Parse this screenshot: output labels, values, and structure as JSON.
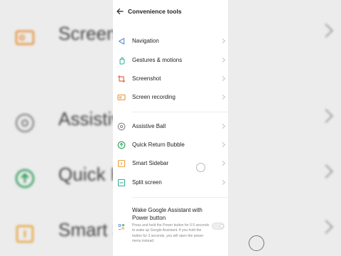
{
  "background": {
    "items": [
      {
        "label": "Screen",
        "icon": "screen-recording-icon"
      },
      {
        "label": "Assistive",
        "icon": "assistive-ball-icon"
      },
      {
        "label": "Quick R",
        "icon": "quick-return-bubble-icon"
      },
      {
        "label": "Smart S",
        "icon": "smart-sidebar-icon"
      }
    ]
  },
  "header": {
    "title": "Convenience tools",
    "back_icon": "back-arrow-icon"
  },
  "items": [
    {
      "label": "Navigation",
      "icon": "navigation-icon"
    },
    {
      "label": "Gestures & motions",
      "icon": "gestures-icon"
    },
    {
      "label": "Screenshot",
      "icon": "screenshot-icon"
    },
    {
      "label": "Screen recording",
      "icon": "screen-recording-icon"
    },
    {
      "label": "Assistive Ball",
      "icon": "assistive-ball-icon"
    },
    {
      "label": "Quick Return Bubble",
      "icon": "quick-return-bubble-icon"
    },
    {
      "label": "Smart Sidebar",
      "icon": "smart-sidebar-icon"
    },
    {
      "label": "Split screen",
      "icon": "split-screen-icon"
    }
  ],
  "wake": {
    "title": "Wake Google Assistant with Power button",
    "description": "Press and hold the Power button for 0.5 seconds to wake up Google Assistant. If you hold the button for 3 seconds, you will open the power menu instead.",
    "enabled": false,
    "icon": "google-assistant-icon"
  },
  "colors": {
    "navigation": "#5b8bd6",
    "gestures": "#2fae96",
    "screenshot": "#e26a4a",
    "recording": "#e8923a",
    "assistive": "#8a8a8a",
    "quick_return": "#2f9e5b",
    "sidebar": "#e8a33a",
    "split": "#2fae96"
  }
}
